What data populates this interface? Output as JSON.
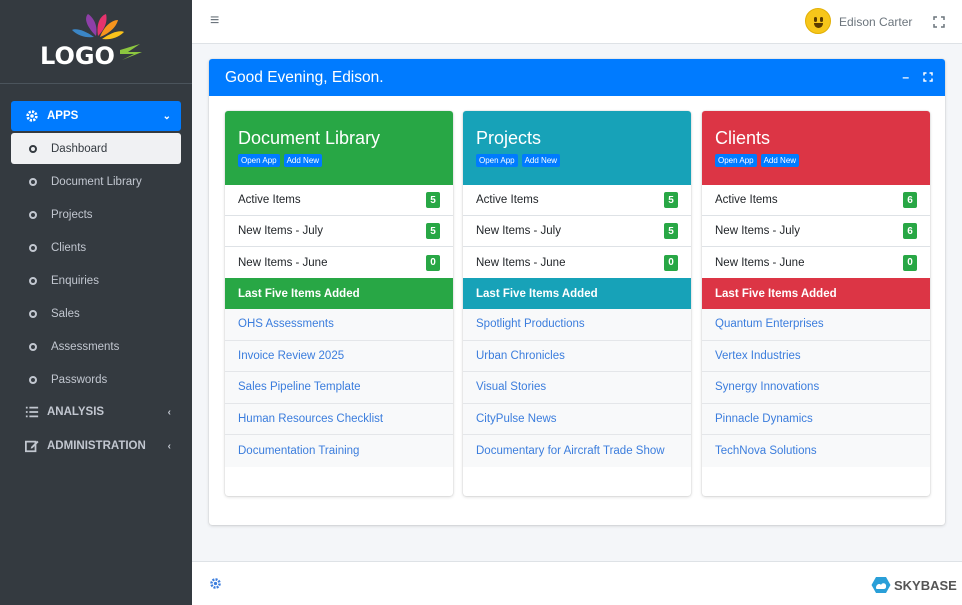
{
  "brand": {
    "logo_text": "LOGO"
  },
  "sidebar": {
    "apps_label": "APPS",
    "apps_items": [
      {
        "label": "Dashboard",
        "active": true
      },
      {
        "label": "Document Library"
      },
      {
        "label": "Projects"
      },
      {
        "label": "Clients"
      },
      {
        "label": "Enquiries"
      },
      {
        "label": "Sales"
      },
      {
        "label": "Assessments"
      },
      {
        "label": "Passwords"
      }
    ],
    "analysis_label": "ANALYSIS",
    "administration_label": "ADMINISTRATION"
  },
  "topbar": {
    "user_name": "Edison Carter"
  },
  "main": {
    "greeting": "Good Evening, Edison.",
    "cards": [
      {
        "title": "Document Library",
        "color": "#28a745",
        "open_label": "Open App",
        "add_label": "Add New",
        "stats": [
          {
            "label": "Active Items",
            "value": "5"
          },
          {
            "label": "New Items - July",
            "value": "5"
          },
          {
            "label": "New Items - June",
            "value": "0"
          }
        ],
        "last_label": "Last Five Items Added",
        "items": [
          "OHS Assessments",
          "Invoice Review 2025",
          "Sales Pipeline Template",
          "Human Resources Checklist",
          "Documentation Training"
        ]
      },
      {
        "title": "Projects",
        "color": "#17a2b8",
        "open_label": "Open App",
        "add_label": "Add New",
        "stats": [
          {
            "label": "Active Items",
            "value": "5"
          },
          {
            "label": "New Items - July",
            "value": "5"
          },
          {
            "label": "New Items - June",
            "value": "0"
          }
        ],
        "last_label": "Last Five Items Added",
        "items": [
          "Spotlight Productions",
          "Urban Chronicles",
          "Visual Stories",
          "CityPulse News",
          "Documentary for Aircraft Trade Show"
        ]
      },
      {
        "title": "Clients",
        "color": "#dc3545",
        "open_label": "Open App",
        "add_label": "Add New",
        "stats": [
          {
            "label": "Active Items",
            "value": "6"
          },
          {
            "label": "New Items - July",
            "value": "6"
          },
          {
            "label": "New Items - June",
            "value": "0"
          }
        ],
        "last_label": "Last Five Items Added",
        "items": [
          "Quantum Enterprises",
          "Vertex Industries",
          "Synergy Innovations",
          "Pinnacle Dynamics",
          "TechNova Solutions"
        ]
      }
    ]
  },
  "footer": {
    "brand": "SKYBASE"
  },
  "icons": {
    "hamburger": "hamburger-icon",
    "fullscreen": "expand-icon",
    "settings": "gear-icon"
  }
}
